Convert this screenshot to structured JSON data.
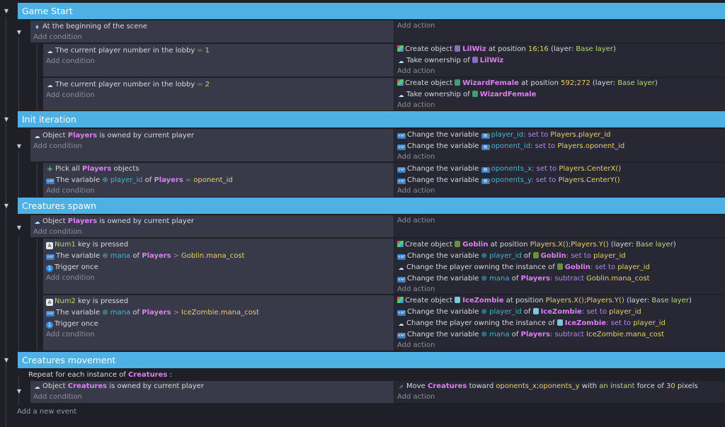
{
  "common": {
    "add_condition": "Add condition",
    "add_action": "Add action",
    "add_event": "Add a new event"
  },
  "groups": [
    {
      "title": "Game Start"
    },
    {
      "title": "Init iteration"
    },
    {
      "title": "Creatures spawn"
    },
    {
      "title": "Creatures movement"
    }
  ],
  "e1": {
    "cond": "At the beginning of the scene",
    "sub1": {
      "cond_text": "The current player number in the lobby",
      "cond_op": "=",
      "cond_val": "1",
      "a1": {
        "pre": "Create object",
        "obj": "LilWiz",
        "mid": "at position",
        "pos": "16;16",
        "l1": "(layer:",
        "layer": "Base layer",
        "l2": ")"
      },
      "a2": {
        "pre": "Take ownership of",
        "obj": "LilWiz"
      }
    },
    "sub2": {
      "cond_text": "The current player number in the lobby",
      "cond_op": "=",
      "cond_val": "2",
      "a1": {
        "pre": "Create object",
        "obj": "WizardFemale",
        "mid": "at position",
        "pos": "592;272",
        "l1": "(layer:",
        "layer": "Base layer",
        "l2": ")"
      },
      "a2": {
        "pre": "Take ownership of",
        "obj": "WizardFemale"
      }
    }
  },
  "e2": {
    "c_pre": "Object",
    "c_obj": "Players",
    "c_post": "is owned by current player",
    "a1": {
      "pre": "Change the variable",
      "var": "player_id",
      "kw": ": set to",
      "expr": "Players.player_id"
    },
    "a2": {
      "pre": "Change the variable",
      "var": "oponent_id",
      "kw": ": set to",
      "expr": "Players.oponent_id"
    },
    "sub": {
      "c1_pre": "Pick all",
      "c1_obj": "Players",
      "c1_post": "objects",
      "c2_pre": "The variable",
      "c2_var": "player_id",
      "c2_of": "of",
      "c2_obj": "Players",
      "c2_op": "=",
      "c2_val": "oponent_id",
      "a1": {
        "pre": "Change the variable",
        "var": "oponents_x",
        "kw": ": set to",
        "expr": "Players.CenterX()"
      },
      "a2": {
        "pre": "Change the variable",
        "var": "oponents_y",
        "kw": ": set to",
        "expr": "Players.CenterY()"
      }
    }
  },
  "e3": {
    "c_pre": "Object",
    "c_obj": "Players",
    "c_post": "is owned by current player",
    "sub1": {
      "k_key": "Num1",
      "k_post": "key is pressed",
      "v_pre": "The variable",
      "v_var": "mana",
      "v_of": "of",
      "v_obj": "Players",
      "v_op": ">",
      "v_val": "Goblin.mana_cost",
      "t": "Trigger once",
      "a1": {
        "pre": "Create object",
        "obj": "Goblin",
        "mid": "at position",
        "pos": "Players.X();Players.Y()",
        "l1": "(layer:",
        "layer": "Base layer",
        "l2": ")"
      },
      "a2": {
        "pre": "Change the variable",
        "var": "player_id",
        "of": "of",
        "obj": "Goblin",
        "kw": ": set to",
        "expr": "player_id"
      },
      "a3": {
        "pre": "Change the player owning the instance of",
        "obj": "Goblin",
        "kw": ": set to",
        "expr": "player_id"
      },
      "a4": {
        "pre": "Change the variable",
        "var": "mana",
        "of": "of",
        "obj": "Players",
        "kw": ": subtract",
        "expr": "Goblin.mana_cost"
      }
    },
    "sub2": {
      "k_key": "Num2",
      "k_post": "key is pressed",
      "v_pre": "The variable",
      "v_var": "mana",
      "v_of": "of",
      "v_obj": "Players",
      "v_op": ">",
      "v_val": "IceZombie.mana_cost",
      "t": "Trigger once",
      "a1": {
        "pre": "Create object",
        "obj": "IceZombie",
        "mid": "at position",
        "pos": "Players.X();Players.Y()",
        "l1": "(layer:",
        "layer": "Base layer",
        "l2": ")"
      },
      "a2": {
        "pre": "Change the variable",
        "var": "player_id",
        "of": "of",
        "obj": "IceZombie",
        "kw": ": set to",
        "expr": "player_id"
      },
      "a3": {
        "pre": "Change the player owning the instance of",
        "obj": "IceZombie",
        "kw": ": set to",
        "expr": "player_id"
      },
      "a4": {
        "pre": "Change the variable",
        "var": "mana",
        "of": "of",
        "obj": "Players",
        "kw": ": subtract",
        "expr": "IceZombie.mana_cost"
      }
    }
  },
  "e4": {
    "repeat_pre": "Repeat for each instance of",
    "repeat_obj": "Creatures",
    "repeat_post": ":",
    "c_pre": "Object",
    "c_obj": "Creatures",
    "c_post": "is owned by current player",
    "a1": {
      "pre": "Move",
      "obj": "Creatures",
      "mid": "toward",
      "target": "oponents_x;oponents_y",
      "with": "with",
      "inst": "an instant",
      "force": "force of",
      "val": "30",
      "unit": "pixels"
    }
  },
  "colors": {
    "group": "#4fb1e3",
    "condition_bg": "#383a49",
    "action_bg": "#272833",
    "object": "#dc7ff2",
    "variable": "#44b6ca",
    "number": "#e6cf6a"
  }
}
